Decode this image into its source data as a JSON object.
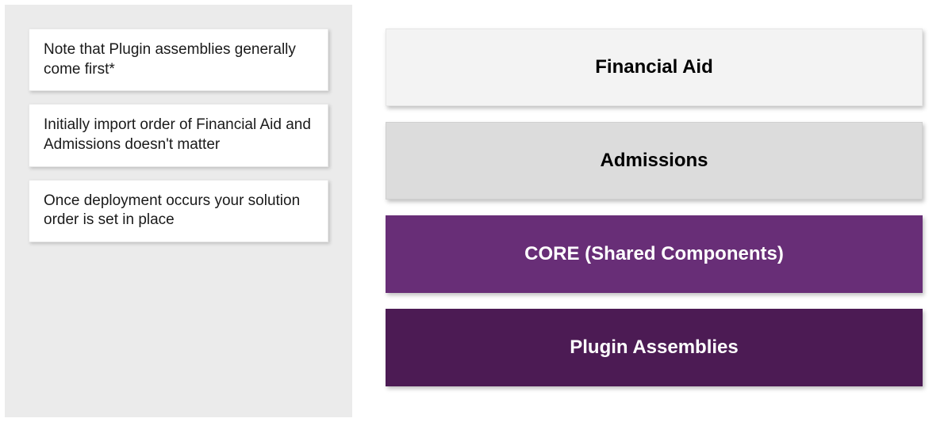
{
  "notes": [
    "Note that Plugin assemblies generally come first*",
    "Initially import order of Financial Aid and Admissions doesn't matter",
    "Once deployment occurs your solution order is set in place"
  ],
  "layers": [
    {
      "label": "Financial Aid"
    },
    {
      "label": "Admissions"
    },
    {
      "label": "CORE (Shared Components)"
    },
    {
      "label": "Plugin Assemblies"
    }
  ]
}
